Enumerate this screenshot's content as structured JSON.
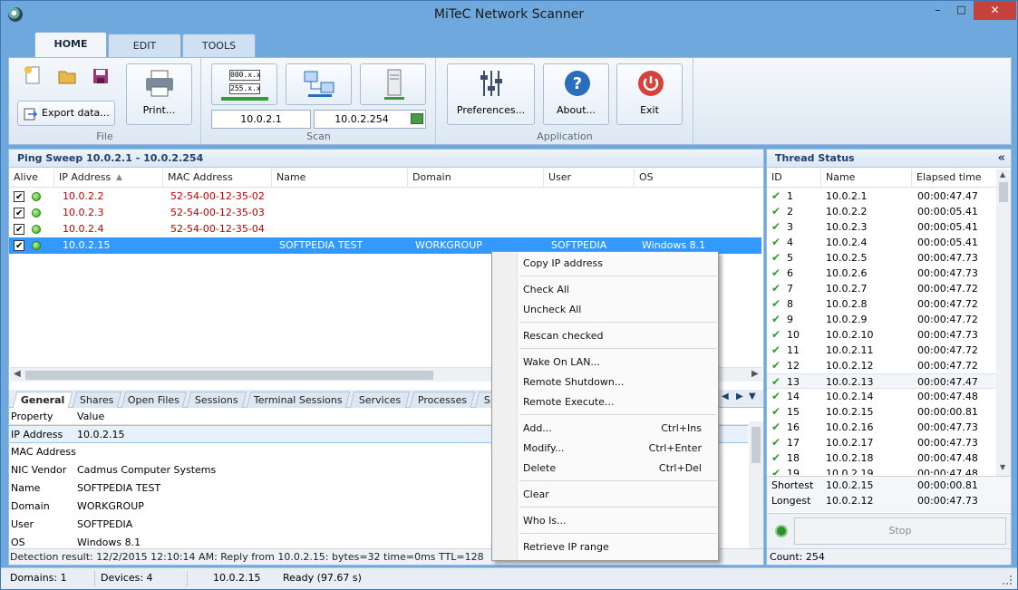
{
  "window": {
    "title": "MiTeC Network Scanner",
    "min": "–",
    "max": "□",
    "close": "✕"
  },
  "ribbon": {
    "tabs": [
      "HOME",
      "EDIT",
      "TOOLS"
    ],
    "file": {
      "export_label": "Export data...",
      "print_label": "Print...",
      "group_label": "File"
    },
    "scan": {
      "range_start": "10.0.2.1",
      "range_end": "10.0.2.254",
      "group_label": "Scan",
      "btn1_top": "000.x.x",
      "btn1_bottom": "255.x.x"
    },
    "application": {
      "preferences_label": "Preferences...",
      "about_label": "About...",
      "exit_label": "Exit",
      "group_label": "Application"
    }
  },
  "ping": {
    "header": "Ping Sweep 10.0.2.1 - 10.0.2.254",
    "columns": [
      "Alive",
      "IP Address",
      "MAC Address",
      "Name",
      "Domain",
      "User",
      "OS"
    ],
    "rows": [
      {
        "ip": "10.0.2.2",
        "mac": "52-54-00-12-35-02",
        "name": "",
        "domain": "",
        "user": "",
        "os": ""
      },
      {
        "ip": "10.0.2.3",
        "mac": "52-54-00-12-35-03",
        "name": "",
        "domain": "",
        "user": "",
        "os": ""
      },
      {
        "ip": "10.0.2.4",
        "mac": "52-54-00-12-35-04",
        "name": "",
        "domain": "",
        "user": "",
        "os": ""
      },
      {
        "ip": "10.0.2.15",
        "mac": "",
        "name": "SOFTPEDIA TEST",
        "domain": "WORKGROUP",
        "user": "SOFTPEDIA",
        "os": "Windows 8.1"
      }
    ]
  },
  "details": {
    "tabs": [
      "General",
      "Shares",
      "Open Files",
      "Sessions",
      "Terminal Sessions",
      "Services",
      "Processes",
      "S"
    ],
    "columns": [
      "Property",
      "Value"
    ],
    "rows": [
      {
        "k": "IP Address",
        "v": "10.0.2.15"
      },
      {
        "k": "MAC Address",
        "v": ""
      },
      {
        "k": "NIC Vendor",
        "v": "Cadmus Computer Systems"
      },
      {
        "k": "Name",
        "v": "SOFTPEDIA TEST"
      },
      {
        "k": "Domain",
        "v": "WORKGROUP"
      },
      {
        "k": "User",
        "v": "SOFTPEDIA"
      },
      {
        "k": "OS",
        "v": "Windows 8.1"
      }
    ],
    "detection": "Detection result:  12/2/2015 12:10:14 AM: Reply from 10.0.2.15: bytes=32 time=0ms TTL=128"
  },
  "thread": {
    "header": "Thread Status",
    "collapse": "«",
    "columns": [
      "ID",
      "Name",
      "Elapsed time"
    ],
    "rows": [
      {
        "id": "1",
        "name": "10.0.2.1",
        "t": "00:00:47.47"
      },
      {
        "id": "2",
        "name": "10.0.2.2",
        "t": "00:00:05.41"
      },
      {
        "id": "3",
        "name": "10.0.2.3",
        "t": "00:00:05.41"
      },
      {
        "id": "4",
        "name": "10.0.2.4",
        "t": "00:00:05.41"
      },
      {
        "id": "5",
        "name": "10.0.2.5",
        "t": "00:00:47.73"
      },
      {
        "id": "6",
        "name": "10.0.2.6",
        "t": "00:00:47.73"
      },
      {
        "id": "7",
        "name": "10.0.2.7",
        "t": "00:00:47.72"
      },
      {
        "id": "8",
        "name": "10.0.2.8",
        "t": "00:00:47.72"
      },
      {
        "id": "9",
        "name": "10.0.2.9",
        "t": "00:00:47.72"
      },
      {
        "id": "10",
        "name": "10.0.2.10",
        "t": "00:00:47.73"
      },
      {
        "id": "11",
        "name": "10.0.2.11",
        "t": "00:00:47.72"
      },
      {
        "id": "12",
        "name": "10.0.2.12",
        "t": "00:00:47.72"
      },
      {
        "id": "13",
        "name": "10.0.2.13",
        "t": "00:00:47.47"
      },
      {
        "id": "14",
        "name": "10.0.2.14",
        "t": "00:00:47.48"
      },
      {
        "id": "15",
        "name": "10.0.2.15",
        "t": "00:00:00.81"
      },
      {
        "id": "16",
        "name": "10.0.2.16",
        "t": "00:00:47.73"
      },
      {
        "id": "17",
        "name": "10.0.2.17",
        "t": "00:00:47.73"
      },
      {
        "id": "18",
        "name": "10.0.2.18",
        "t": "00:00:47.48"
      },
      {
        "id": "19",
        "name": "10.0.2.19",
        "t": "00:00:47.48"
      }
    ],
    "shortest_label": "Shortest",
    "shortest_name": "10.0.2.15",
    "shortest_time": "00:00:00.81",
    "longest_label": "Longest",
    "longest_name": "10.0.2.12",
    "longest_time": "00:00:47.73",
    "stop_label": "Stop",
    "count": "Count: 254"
  },
  "statusbar": {
    "domains": "Domains: 1",
    "devices": "Devices: 4",
    "ip": "10.0.2.15",
    "status": "Ready (97.67 s)"
  },
  "context_menu": {
    "copy_ip": "Copy IP address",
    "check_all": "Check All",
    "uncheck_all": "Uncheck All",
    "rescan": "Rescan checked",
    "wol": "Wake On LAN...",
    "shutdown": "Remote Shutdown...",
    "execute": "Remote Execute...",
    "add": "Add...",
    "add_sc": "Ctrl+Ins",
    "modify": "Modify...",
    "modify_sc": "Ctrl+Enter",
    "delete": "Delete",
    "delete_sc": "Ctrl+Del",
    "clear": "Clear",
    "whois": "Who Is...",
    "retrieve": "Retrieve IP range"
  },
  "colors": {
    "accent": "#3399ff",
    "alive_red": "#c00000",
    "ok_green": "#2e9e2e",
    "exit_red": "#d6423a",
    "about_blue": "#2a6ebb"
  }
}
